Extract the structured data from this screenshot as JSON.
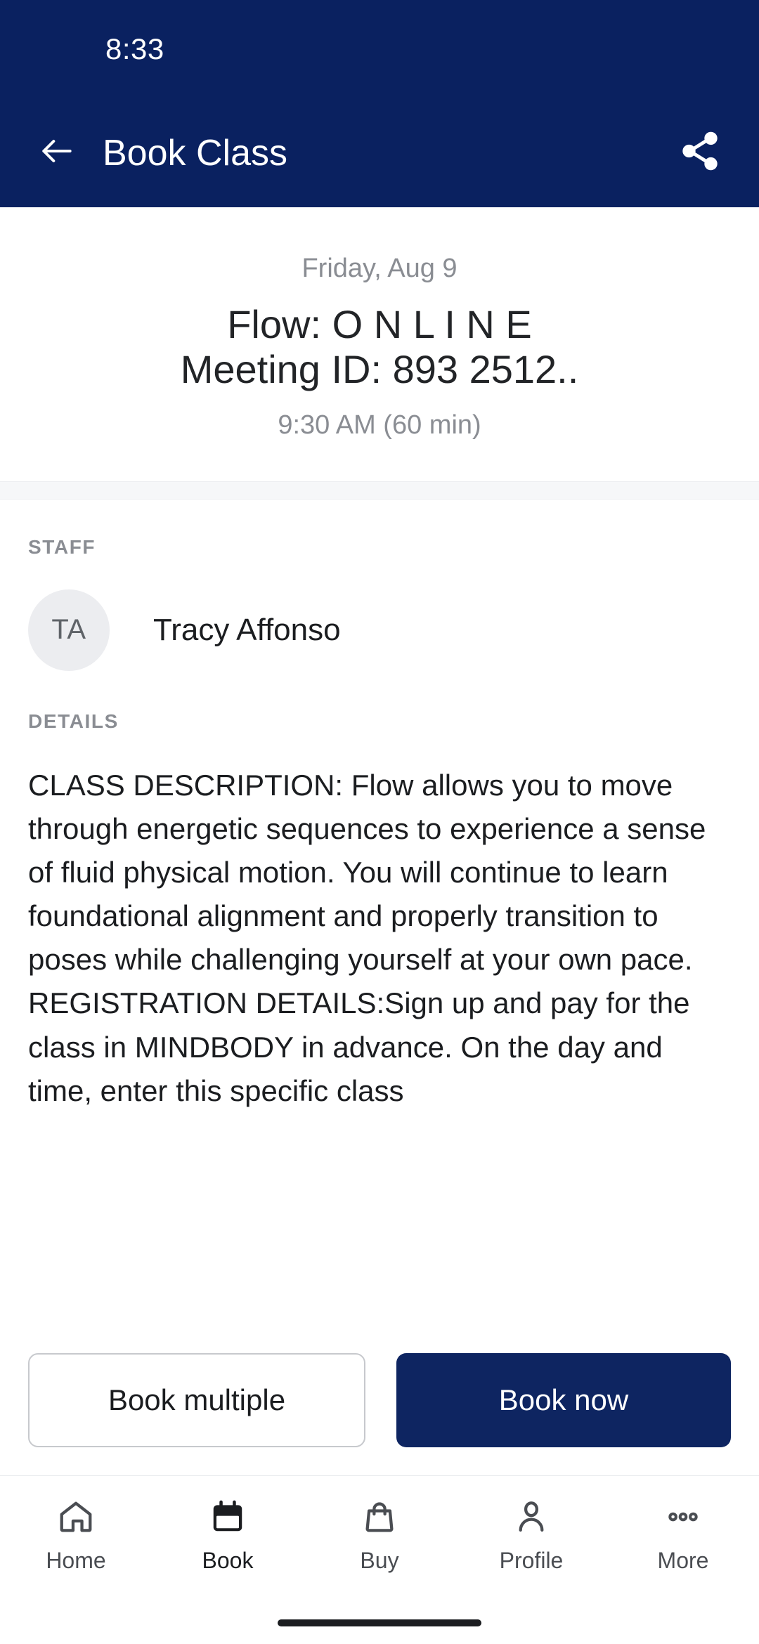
{
  "status_bar": {
    "time": "8:33"
  },
  "app_bar": {
    "title": "Book Class",
    "back_icon": "arrow-left-icon",
    "share_icon": "share-icon"
  },
  "class_header": {
    "date": "Friday, Aug 9",
    "name": "Flow: O N L I N E\nMeeting ID: 893 2512..",
    "time": "9:30 AM (60 min)"
  },
  "staff_section": {
    "label": "STAFF",
    "members": [
      {
        "initials": "TA",
        "name": "Tracy Affonso"
      }
    ]
  },
  "details_section": {
    "label": "DETAILS",
    "text": "CLASS DESCRIPTION: Flow allows you to move through energetic sequences to experience a sense of fluid physical motion. You will continue to learn foundational alignment and properly transition to poses while challenging yourself at your own pace. REGISTRATION DETAILS:Sign up and pay for the class in MINDBODY in advance. On the day and time, enter this specific class"
  },
  "actions": {
    "book_multiple_label": "Book multiple",
    "book_now_label": "Book now"
  },
  "bottom_nav": {
    "items": [
      {
        "label": "Home",
        "icon": "home-icon",
        "active": false
      },
      {
        "label": "Book",
        "icon": "calendar-icon",
        "active": true
      },
      {
        "label": "Buy",
        "icon": "bag-icon",
        "active": false
      },
      {
        "label": "Profile",
        "icon": "person-icon",
        "active": false
      },
      {
        "label": "More",
        "icon": "more-dots-icon",
        "active": false
      }
    ]
  },
  "colors": {
    "navy": "#0A2160",
    "primary_button": "#0E2561",
    "muted_text": "#8a8d93",
    "body_text": "#1b1d20"
  }
}
